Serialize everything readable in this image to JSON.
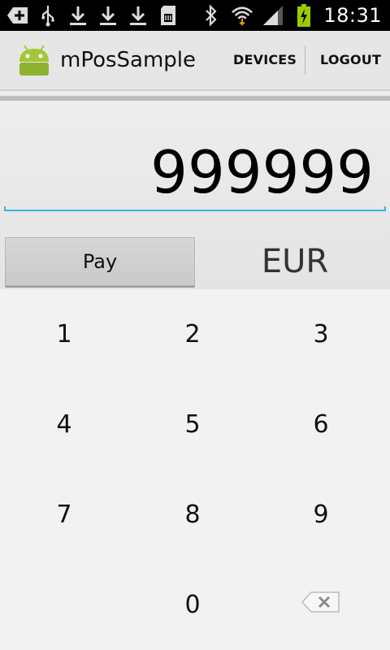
{
  "status_bar": {
    "time": "18:31",
    "left_icons": [
      "add-notification-icon",
      "usb-icon",
      "download-icon",
      "download-icon",
      "download-icon",
      "sd-card-icon"
    ],
    "right_icons": [
      "bluetooth-icon",
      "wifi-icon",
      "signal-icon",
      "battery-charging-icon"
    ]
  },
  "action_bar": {
    "title": "mPosSample",
    "actions": [
      "DEVICES",
      "LOGOUT"
    ]
  },
  "amount": {
    "value": "999999",
    "currency": "EUR",
    "pay_label": "Pay"
  },
  "keypad": {
    "keys": [
      "1",
      "2",
      "3",
      "4",
      "5",
      "6",
      "7",
      "8",
      "9",
      "0"
    ],
    "backspace_icon": "backspace-icon"
  },
  "colors": {
    "accent": "#33b5e5",
    "android_green": "#a4c639",
    "battery_charging": "#99cc00"
  }
}
